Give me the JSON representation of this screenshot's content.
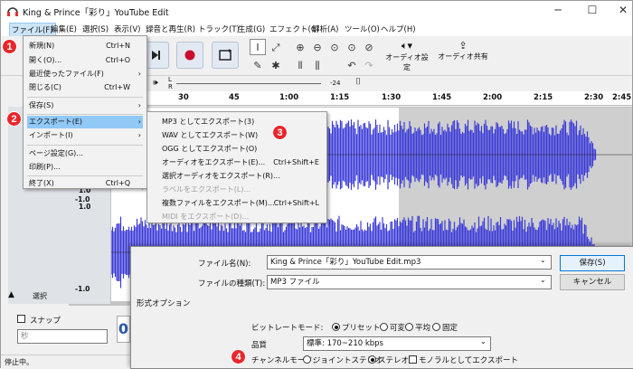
{
  "window": {
    "title": "King & Prince「彩り」YouTube Edit",
    "minimize": "─",
    "maximize": "☐",
    "close": "✕"
  },
  "menubar": [
    "ファイル(F)",
    "編集(E)",
    "選択(S)",
    "表示(V)",
    "録音と再生(R)",
    "トラック(T)",
    "生成(G)",
    "エフェクト(C)",
    "解析(A)",
    "ツール(O)",
    "ヘルプ(H)"
  ],
  "toolbar": {
    "audio_setup": "オーディオ設定",
    "share_audio": "オーディオ共有",
    "meter_l": "L",
    "meter_r": "R",
    "meter_value": "-24"
  },
  "ruler": [
    "30",
    "45",
    "1:00",
    "1:15",
    "1:30",
    "1:45",
    "2:00",
    "2:15",
    "2:30",
    "2:45"
  ],
  "file_menu": [
    {
      "label": "新規(N)",
      "shortcut": "Ctrl+N"
    },
    {
      "label": "開く(O)...",
      "shortcut": "Ctrl+O"
    },
    {
      "label": "最近使ったファイル(F)",
      "shortcut": "",
      "arrow": "›"
    },
    {
      "label": "閉じる(C)",
      "shortcut": "Ctrl+W"
    },
    {
      "label": "保存(S)",
      "shortcut": "",
      "arrow": "›"
    },
    {
      "label": "エクスポート(E)",
      "shortcut": "",
      "arrow": "›"
    },
    {
      "label": "インポート(I)",
      "shortcut": "",
      "arrow": "›"
    },
    {
      "label": "ページ設定(G)...",
      "shortcut": ""
    },
    {
      "label": "印刷(P)...",
      "shortcut": ""
    },
    {
      "label": "終了(X)",
      "shortcut": "Ctrl+Q"
    }
  ],
  "export_submenu": [
    {
      "label": "MP3 としてエクスポート(3)",
      "shortcut": ""
    },
    {
      "label": "WAV としてエクスポート(W)",
      "shortcut": ""
    },
    {
      "label": "OGG としてエクスポート(O)",
      "shortcut": ""
    },
    {
      "label": "オーディオをエクスポート(E)...",
      "shortcut": "Ctrl+Shift+E"
    },
    {
      "label": "選択オーディオをエクスポート(R)...",
      "shortcut": ""
    },
    {
      "label": "ラベルをエクスポート(L)...",
      "shortcut": ""
    },
    {
      "label": "複数ファイルをエクスポート(M)...",
      "shortcut": "Ctrl+Shift+L"
    },
    {
      "label": "MIDI をエクスポート(D)...",
      "shortcut": ""
    }
  ],
  "badges": [
    "1",
    "2",
    "3",
    "4"
  ],
  "track": {
    "scale_top": "1.0",
    "scale_mid": "-1.0",
    "scale_mid2": "1.0",
    "scale_bottom": "-1.0",
    "select": "選択"
  },
  "snap": {
    "label": "スナップ",
    "unit": "秒"
  },
  "status": "停止中。",
  "dialog": {
    "filename_label": "ファイル名(N):",
    "filename_value": "King & Prince「彩り」YouTube Edit.mp3",
    "filetype_label": "ファイルの種類(T):",
    "filetype_value": "MP3 ファイル",
    "save": "保存(S)",
    "cancel": "キャンセル",
    "format_options": "形式オプション",
    "bitrate_label": "ビットレートモード:",
    "bitrate_options": [
      "プリセット",
      "可変",
      "平均",
      "固定"
    ],
    "quality_label": "品質",
    "quality_value": "標準: 170~210 kbps",
    "channel_label": "チャンネルモード:",
    "channel_options": [
      "ジョイントステレオ",
      "ステレオ"
    ],
    "mono_label": "モノラルとしてエクスポート"
  },
  "colors": {
    "accent_red": "#e8262b",
    "wave": "#3b3bd8",
    "highlight": "#91c9f7"
  }
}
